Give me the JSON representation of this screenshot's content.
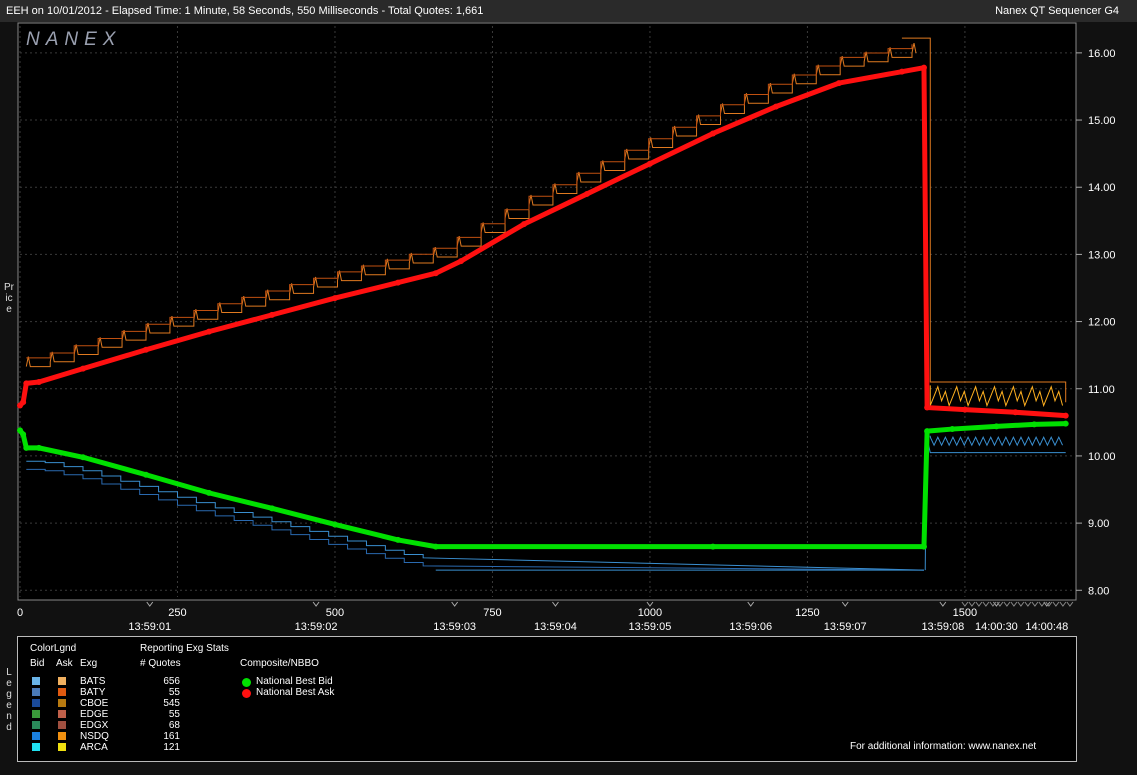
{
  "header": {
    "title_left": "EEH on 10/01/2012  -  Elapsed Time: 1 Minute, 58 Seconds, 550 Milliseconds  -  Total Quotes: 1,661",
    "title_right": "Nanex QT Sequencer G4",
    "logo": "NANEX"
  },
  "side_labels": {
    "price": "Price",
    "legend": "Legend"
  },
  "colors": {
    "background": "#000000",
    "grid": "#3a3a3a",
    "bid_line": "#00e000",
    "ask_line": "#ff1010",
    "bid_steps": "#3a8fd0",
    "ask_steps": "#e07a20",
    "ask_spikes": "#ffb020"
  },
  "legend": {
    "heading": "ColorLgnd",
    "stats_heading": "Reporting Exg Stats",
    "col_bid": "Bid",
    "col_ask": "Ask",
    "col_exg": "Exg",
    "col_quotes": "# Quotes",
    "composite_heading": "Composite/NBBO",
    "exchanges": [
      {
        "name": "BATS",
        "quotes": "656",
        "bid_color": "#6ab4e8",
        "ask_color": "#f0b060"
      },
      {
        "name": "BATY",
        "quotes": "55",
        "bid_color": "#4a7ab8",
        "ask_color": "#e05a10"
      },
      {
        "name": "CBOE",
        "quotes": "545",
        "bid_color": "#1a4a9a",
        "ask_color": "#b87a10"
      },
      {
        "name": "EDGE",
        "quotes": "55",
        "bid_color": "#3a9a3a",
        "ask_color": "#c0604a"
      },
      {
        "name": "EDGX",
        "quotes": "68",
        "bid_color": "#2a8a5a",
        "ask_color": "#a05040"
      },
      {
        "name": "NSDQ",
        "quotes": "161",
        "bid_color": "#1a80e0",
        "ask_color": "#f09010"
      },
      {
        "name": "ARCA",
        "quotes": "121",
        "bid_color": "#20e0f0",
        "ask_color": "#f0e010"
      }
    ],
    "nbbo": [
      {
        "label": "National Best Bid",
        "color": "#00e000"
      },
      {
        "label": "National Best Ask",
        "color": "#ff1010"
      }
    ],
    "footer": "For additional information: www.nanex.net"
  },
  "chart_data": {
    "type": "line",
    "ylim": [
      7.9,
      16.4
    ],
    "xlim": [
      0,
      1670
    ],
    "y_ticks": [
      "8.00",
      "9.00",
      "10.00",
      "11.00",
      "12.00",
      "13.00",
      "14.00",
      "15.00",
      "16.00"
    ],
    "x_ticks": [
      "0",
      "250",
      "500",
      "750",
      "1000",
      "1250",
      "1500"
    ],
    "time_labels": [
      {
        "x": 206,
        "label": "13:59:01"
      },
      {
        "x": 470,
        "label": "13:59:02"
      },
      {
        "x": 690,
        "label": "13:59:03"
      },
      {
        "x": 850,
        "label": "13:59:04"
      },
      {
        "x": 1000,
        "label": "13:59:05"
      },
      {
        "x": 1160,
        "label": "13:59:06"
      },
      {
        "x": 1310,
        "label": "13:59:07"
      },
      {
        "x": 1465,
        "label": "13:59:08"
      },
      {
        "x": 1550,
        "label": "14:00:30"
      },
      {
        "x": 1630,
        "label": "14:00:48"
      }
    ],
    "series": [
      {
        "name": "National Best Bid",
        "x": [
          0,
          5,
          10,
          30,
          100,
          200,
          300,
          400,
          500,
          600,
          660,
          1100,
          1435,
          1440,
          1480,
          1550,
          1610,
          1660
        ],
        "y": [
          10.38,
          10.32,
          10.12,
          10.12,
          9.98,
          9.72,
          9.45,
          9.22,
          8.98,
          8.75,
          8.65,
          8.65,
          8.65,
          10.37,
          10.4,
          10.44,
          10.47,
          10.48
        ]
      },
      {
        "name": "National Best Ask",
        "x": [
          0,
          5,
          10,
          30,
          100,
          200,
          300,
          400,
          500,
          600,
          660,
          700,
          800,
          900,
          1000,
          1100,
          1200,
          1300,
          1400,
          1435,
          1440,
          1500,
          1580,
          1660
        ],
        "y": [
          10.75,
          10.8,
          11.08,
          11.1,
          11.3,
          11.58,
          11.85,
          12.1,
          12.35,
          12.58,
          12.72,
          12.9,
          13.45,
          13.9,
          14.35,
          14.8,
          15.2,
          15.55,
          15.72,
          15.78,
          10.72,
          10.69,
          10.65,
          10.6
        ]
      }
    ]
  }
}
